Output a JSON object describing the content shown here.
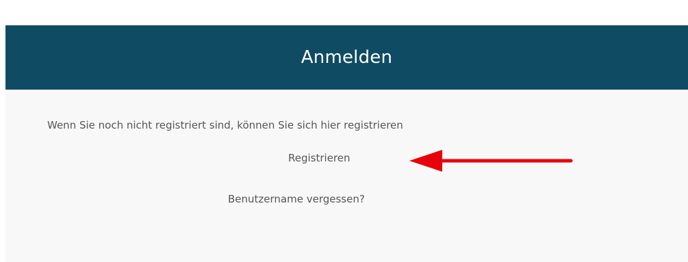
{
  "header": {
    "title": "Anmelden"
  },
  "body": {
    "intro": "Wenn Sie noch nicht registriert sind, können Sie sich hier registrieren",
    "register_link": "Registrieren",
    "forgot_link": "Benutzername vergessen?"
  },
  "colors": {
    "header_bg": "#0f4c63",
    "header_text": "#ffffff",
    "body_text": "#555555",
    "annotation_arrow": "#e8000b"
  },
  "icons": {
    "annotation": "red-arrow-left-icon"
  }
}
